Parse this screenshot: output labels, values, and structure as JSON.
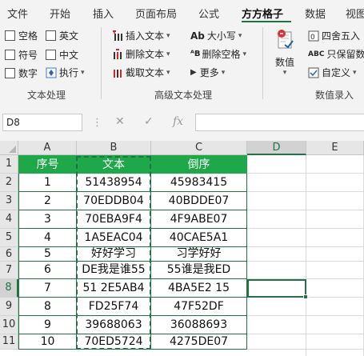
{
  "tabs": [
    "文件",
    "开始",
    "插入",
    "页面布局",
    "公式",
    "方方格子",
    "数据",
    "视图"
  ],
  "active_tab": "方方格子",
  "ribbon": {
    "text_group": {
      "checkboxes": [
        "空格",
        "英文",
        "符号",
        "中文",
        "数字"
      ],
      "execute_label": "执行",
      "label": "文本处理"
    },
    "advanced_group": {
      "insert_text": "插入文本",
      "delete_text": "删除文本",
      "extract_text": "截取文本",
      "case_label": "大小写",
      "delete_spaces": "删除空格",
      "more": "更多",
      "label": "高级文本处理"
    },
    "number_group": {
      "value_label": "数值",
      "round_label": "四舍五入",
      "keep_value_label": "只保留数值",
      "custom_label": "自定义",
      "label": "数值录入"
    }
  },
  "formula_bar": {
    "name_box": "D8",
    "fx_label": "fx",
    "cancel_glyph": "✕",
    "confirm_glyph": "✓"
  },
  "columns": [
    "A",
    "B",
    "C",
    "D",
    "E"
  ],
  "selected_column": "D",
  "selected_row": "8",
  "rows": [
    "1",
    "2",
    "3",
    "4",
    "5",
    "6",
    "7",
    "8",
    "9",
    "10",
    "11"
  ],
  "table": {
    "headers": [
      "序号",
      "文本",
      "倒序"
    ],
    "data": [
      [
        "1",
        "51438954",
        "45983415"
      ],
      [
        "2",
        "70EDDB04",
        "40BDDE07"
      ],
      [
        "3",
        "70EBA9F4",
        "4F9ABE07"
      ],
      [
        "4",
        "1A5EAC04",
        "40CAE5A1"
      ],
      [
        "5",
        "好好学习",
        "习学好好"
      ],
      [
        "6",
        "DE我是谁55",
        "55谁是我ED"
      ],
      [
        "7",
        "51 2E5AB4",
        "4BA5E2 15"
      ],
      [
        "8",
        "FD25F74",
        "47F52DF"
      ],
      [
        "9",
        "39688063",
        "36088693"
      ],
      [
        "10",
        "70ED5724",
        "4275DE07"
      ]
    ]
  },
  "colors": {
    "accent": "#217346",
    "header_fill": "#1ea84a"
  }
}
